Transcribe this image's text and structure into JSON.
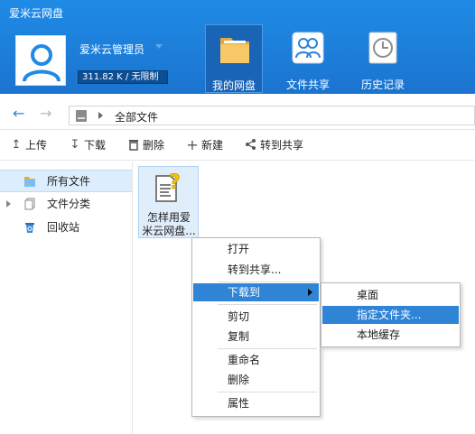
{
  "app": {
    "title": "爱米云网盘"
  },
  "user": {
    "name": "爱米云管理员",
    "quota": "311.82 K / 无限制"
  },
  "nav": [
    {
      "label": "我的网盘",
      "icon": "folder-icon",
      "active": true
    },
    {
      "label": "文件共享",
      "icon": "users-share-icon",
      "active": false
    },
    {
      "label": "历史记录",
      "icon": "clock-icon",
      "active": false
    }
  ],
  "address": {
    "path": "全部文件"
  },
  "toolbar": {
    "upload": "上传",
    "download": "下载",
    "delete": "删除",
    "new": "新建",
    "share": "转到共享"
  },
  "sidebar": {
    "items": [
      {
        "label": "所有文件",
        "icon": "folder-icon",
        "active": true
      },
      {
        "label": "文件分类",
        "icon": "documents-icon",
        "active": false
      },
      {
        "label": "回收站",
        "icon": "recycle-bin-icon",
        "active": false
      }
    ]
  },
  "file": {
    "name_line1": "怎样用爱",
    "name_line2": "米云网盘..."
  },
  "context_menu": {
    "open": "打开",
    "share": "转到共享...",
    "download_to": "下载到",
    "cut": "剪切",
    "copy": "复制",
    "rename": "重命名",
    "delete": "删除",
    "properties": "属性"
  },
  "submenu": {
    "desktop": "桌面",
    "folder": "指定文件夹...",
    "local_cache": "本地缓存"
  },
  "colors": {
    "header": "#1b7ad8",
    "highlight": "#2f84d6",
    "selected": "#dceefd"
  }
}
